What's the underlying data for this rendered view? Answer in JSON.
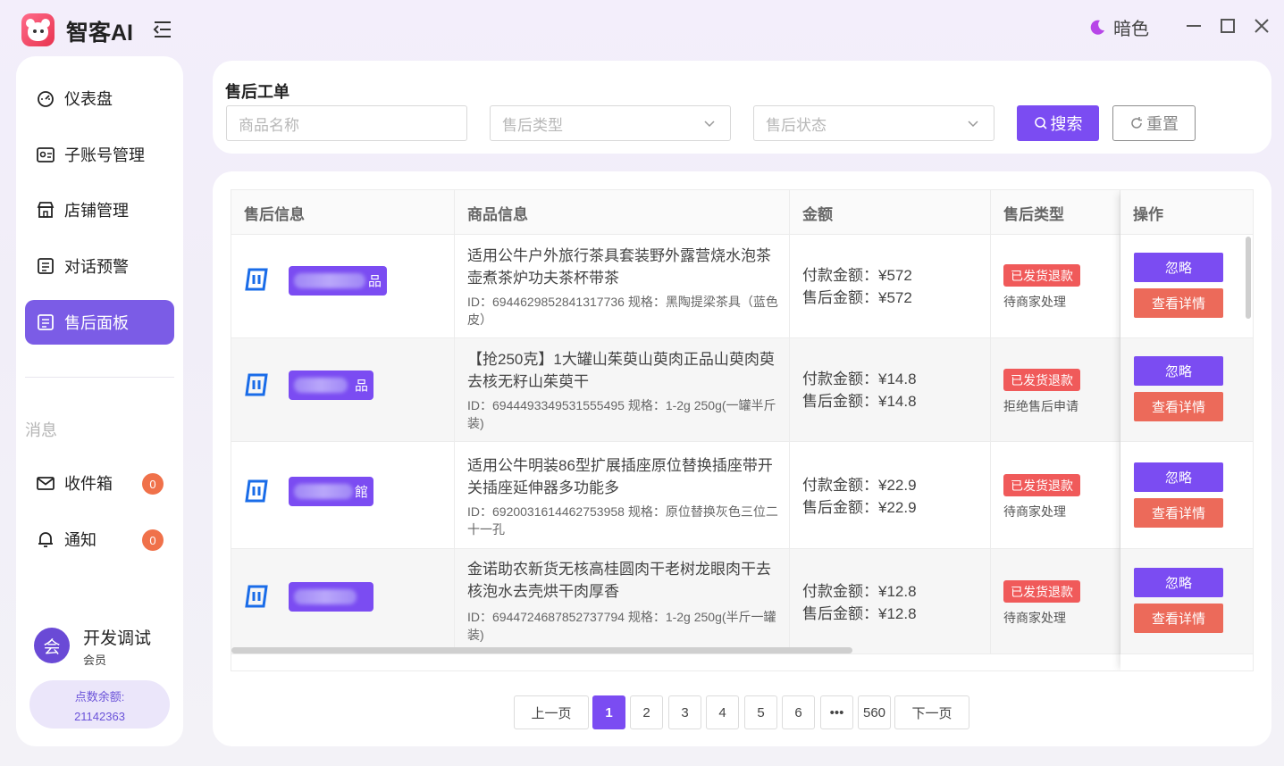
{
  "app": {
    "name": "智客AI",
    "theme_label": "暗色"
  },
  "sidebar": {
    "items": [
      {
        "label": "仪表盘",
        "icon": "dashboard-icon"
      },
      {
        "label": "子账号管理",
        "icon": "id-card-icon"
      },
      {
        "label": "店铺管理",
        "icon": "store-icon"
      },
      {
        "label": "对话预警",
        "icon": "document-icon"
      },
      {
        "label": "售后面板",
        "icon": "clipboard-icon",
        "active": true
      }
    ],
    "messages_title": "消息",
    "message_items": [
      {
        "label": "收件箱",
        "icon": "mail-icon",
        "count": "0"
      },
      {
        "label": "通知",
        "icon": "bell-icon",
        "count": "0"
      }
    ],
    "user": {
      "avatar_text": "会",
      "name": "开发调试",
      "role": "会员"
    },
    "balance": {
      "label": "点数余额:",
      "value": "21142363"
    }
  },
  "filter": {
    "title": "售后工单",
    "product_placeholder": "商品名称",
    "type_placeholder": "售后类型",
    "status_placeholder": "售后状态",
    "search_label": "搜索",
    "reset_label": "重置"
  },
  "table": {
    "columns": [
      "售后信息",
      "商品信息",
      "金额",
      "售后类型",
      "操作"
    ],
    "rows": [
      {
        "shop_suffix": "品",
        "product_name": "适用公牛户外旅行茶具套装野外露营烧水泡茶壶煮茶炉功夫茶杯带茶",
        "product_meta": "ID：6944629852841317736  规格：黑陶提梁茶具（蓝色皮）",
        "pay_amount": "付款金额：¥572",
        "refund_amount": "售后金额：¥572",
        "type_tag": "已发货退款",
        "status": "待商家处理",
        "ignore_label": "忽略",
        "detail_label": "查看详情"
      },
      {
        "shop_suffix": "品",
        "product_name": "【抢250克】1大罐山茱萸山萸肉正品山萸肉萸去核无籽山茱萸干",
        "product_meta": "ID：6944493349531555495  规格：1-2g 250g(一罐半斤装)",
        "pay_amount": "付款金额：¥14.8",
        "refund_amount": "售后金额：¥14.8",
        "type_tag": "已发货退款",
        "status": "拒绝售后申请",
        "ignore_label": "忽略",
        "detail_label": "查看详情"
      },
      {
        "shop_suffix": "館",
        "product_name": "适用公牛明装86型扩展插座原位替换插座带开关插座延伸器多功能多",
        "product_meta": "ID：6920031614462753958  规格：原位替换灰色三位二十一孔",
        "pay_amount": "付款金额：¥22.9",
        "refund_amount": "售后金额：¥22.9",
        "type_tag": "已发货退款",
        "status": "待商家处理",
        "ignore_label": "忽略",
        "detail_label": "查看详情"
      },
      {
        "shop_suffix": "",
        "product_name": "金诺助农新货无核高桂圆肉干老树龙眼肉干去核泡水去壳烘干肉厚香",
        "product_meta": "ID：6944724687852737794  规格：1-2g 250g(半斤一罐装)",
        "pay_amount": "付款金额：¥12.8",
        "refund_amount": "售后金额：¥12.8",
        "type_tag": "已发货退款",
        "status": "待商家处理",
        "ignore_label": "忽略",
        "detail_label": "查看详情"
      }
    ]
  },
  "pagination": {
    "prev_label": "上一页",
    "next_label": "下一页",
    "pages": [
      "1",
      "2",
      "3",
      "4",
      "5",
      "6",
      "•••",
      "560"
    ],
    "current": "1"
  },
  "colors": {
    "accent": "#7b4cf2",
    "danger": "#ec6a5a",
    "badge": "#f0714a"
  }
}
